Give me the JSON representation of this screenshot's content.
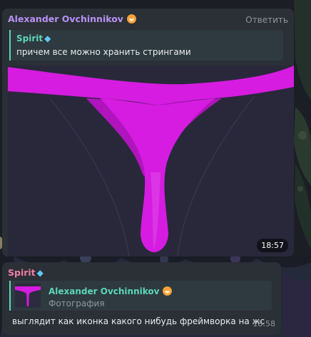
{
  "messages": [
    {
      "author": "Alexander Ovchinnikov",
      "action": "Ответить",
      "reply": {
        "author": "Spirit",
        "text": "причем все можно хранить стрингами"
      },
      "time": "18:57"
    },
    {
      "author": "Spirit",
      "reply": {
        "author": "Alexander Ovchinnikov",
        "text": "Фотография"
      },
      "text": "выглядит как иконка какого нибудь фреймворка на жс",
      "time": "18:58"
    }
  ],
  "icons": {
    "author_badge": "bear-emoji-icon",
    "spirit_badge": "gem-emoji-icon"
  },
  "colors": {
    "photo_magenta": "#d51ce0",
    "photo_background": "#29283b",
    "reply_accent": "#5dd6b7",
    "author_alexander": "#b692f5",
    "author_spirit": "#ee7fa2"
  }
}
